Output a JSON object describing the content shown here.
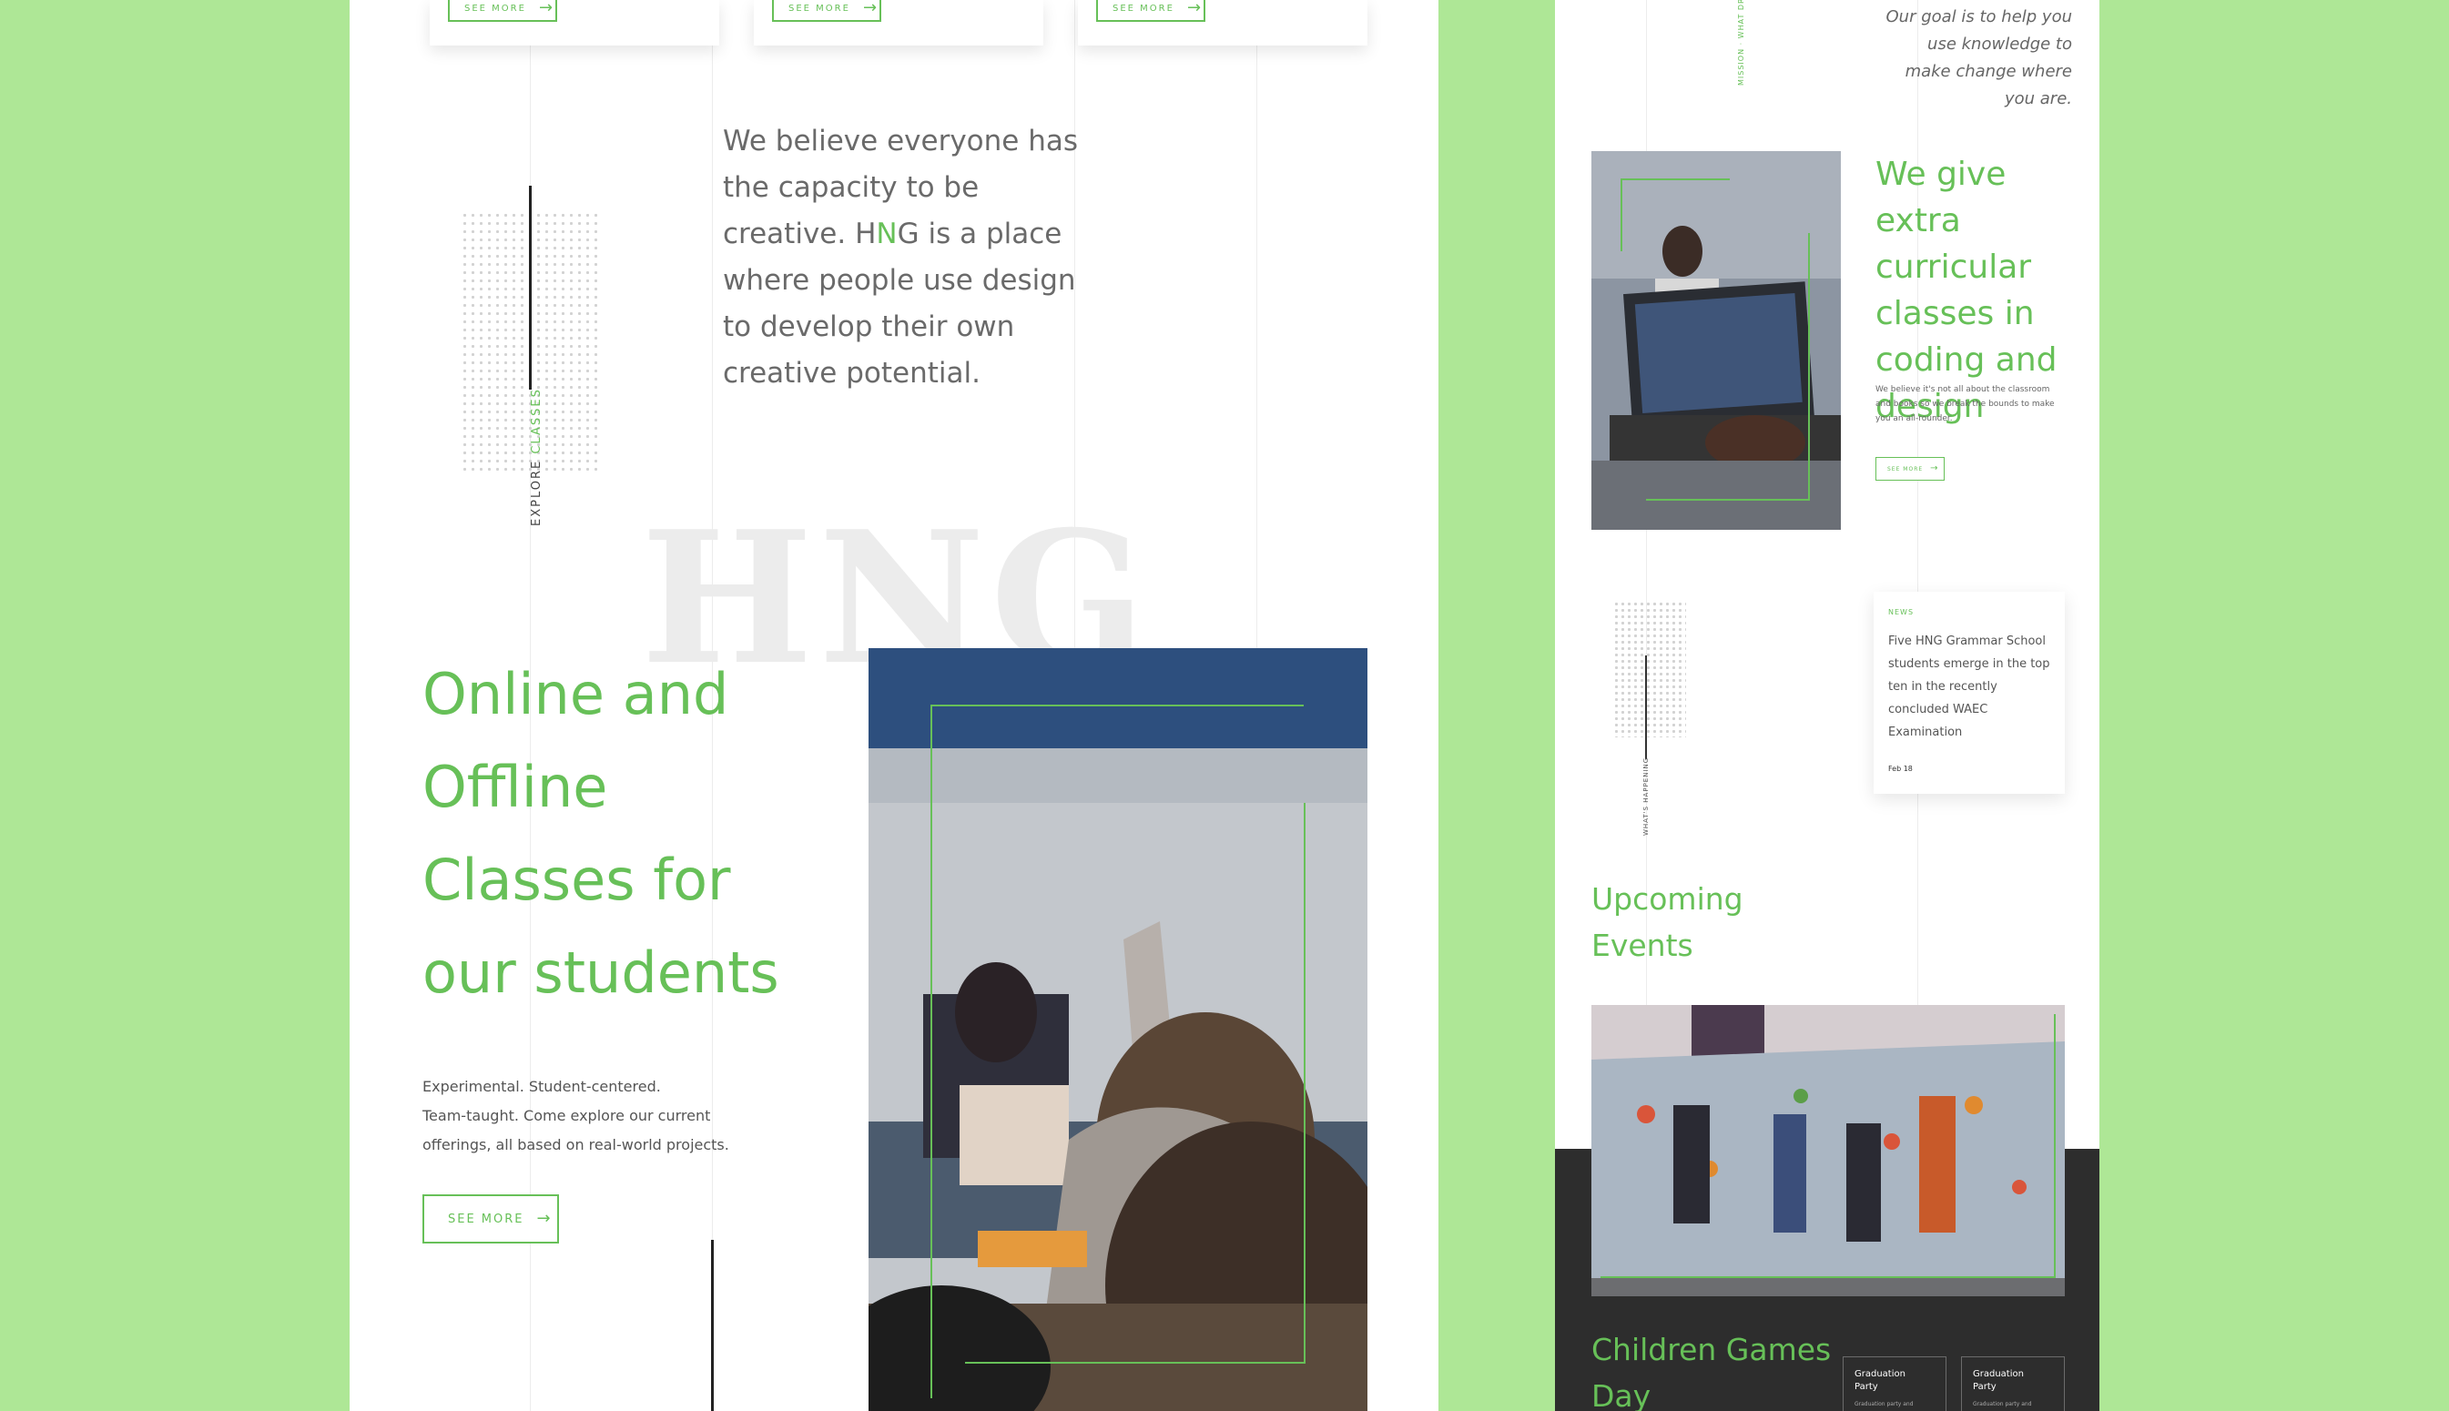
{
  "left": {
    "top_cards": [
      {
        "button": "SEE MORE"
      },
      {
        "button": "SEE MORE"
      },
      {
        "button": "SEE MORE"
      }
    ],
    "explore_label_prefix": "EXPLORE ",
    "explore_label_highlight": "CLASSES",
    "belief_lines": [
      "We believe everyone has",
      "the capacity to be",
      "creative. H",
      "N",
      "G is a place",
      "where people use design",
      "to develop their own",
      "creative potential."
    ],
    "watermark": "HNG",
    "classes_heading": [
      "Online and",
      "Offline",
      "Classes for",
      "our students"
    ],
    "classes_description": [
      "Experimental. Student-centered.",
      "Team-taught. Come explore our current",
      "offerings, all based on real-world projects."
    ],
    "classes_button": "SEE MORE"
  },
  "right": {
    "vertical_label_top": "MISSION · WHAT DRIVES",
    "goal_text": [
      "Our goal is to help you",
      "use knowledge to",
      "make change where",
      "you are."
    ],
    "extra_heading": [
      "We give extra",
      "curricular",
      "classes in",
      "coding and",
      "design"
    ],
    "extra_text": [
      "We believe it's not all about the classroom",
      "and books so we break the bounds to make",
      "you an all-rounder."
    ],
    "extra_button": "SEE MORE",
    "vertical_label_mid": "WHAT'S HAPPENING",
    "news_tag": "NEWS",
    "news_text": [
      "Five HNG Grammar School",
      "students emerge in the top",
      "ten in the recently",
      "concluded WAEC",
      "Examination"
    ],
    "news_date": "Feb 18",
    "events_heading": [
      "Upcoming",
      "Events"
    ],
    "event_title": [
      "Children Games",
      "Day"
    ],
    "event_cards": [
      {
        "title": [
          "Graduation",
          "Party"
        ],
        "sub": "Graduation party and"
      },
      {
        "title": [
          "Graduation",
          "Party"
        ],
        "sub": "Graduation party and"
      }
    ]
  },
  "colors": {
    "accent": "#67c058",
    "background": "#aee796",
    "dark": "#2d2d2d"
  }
}
